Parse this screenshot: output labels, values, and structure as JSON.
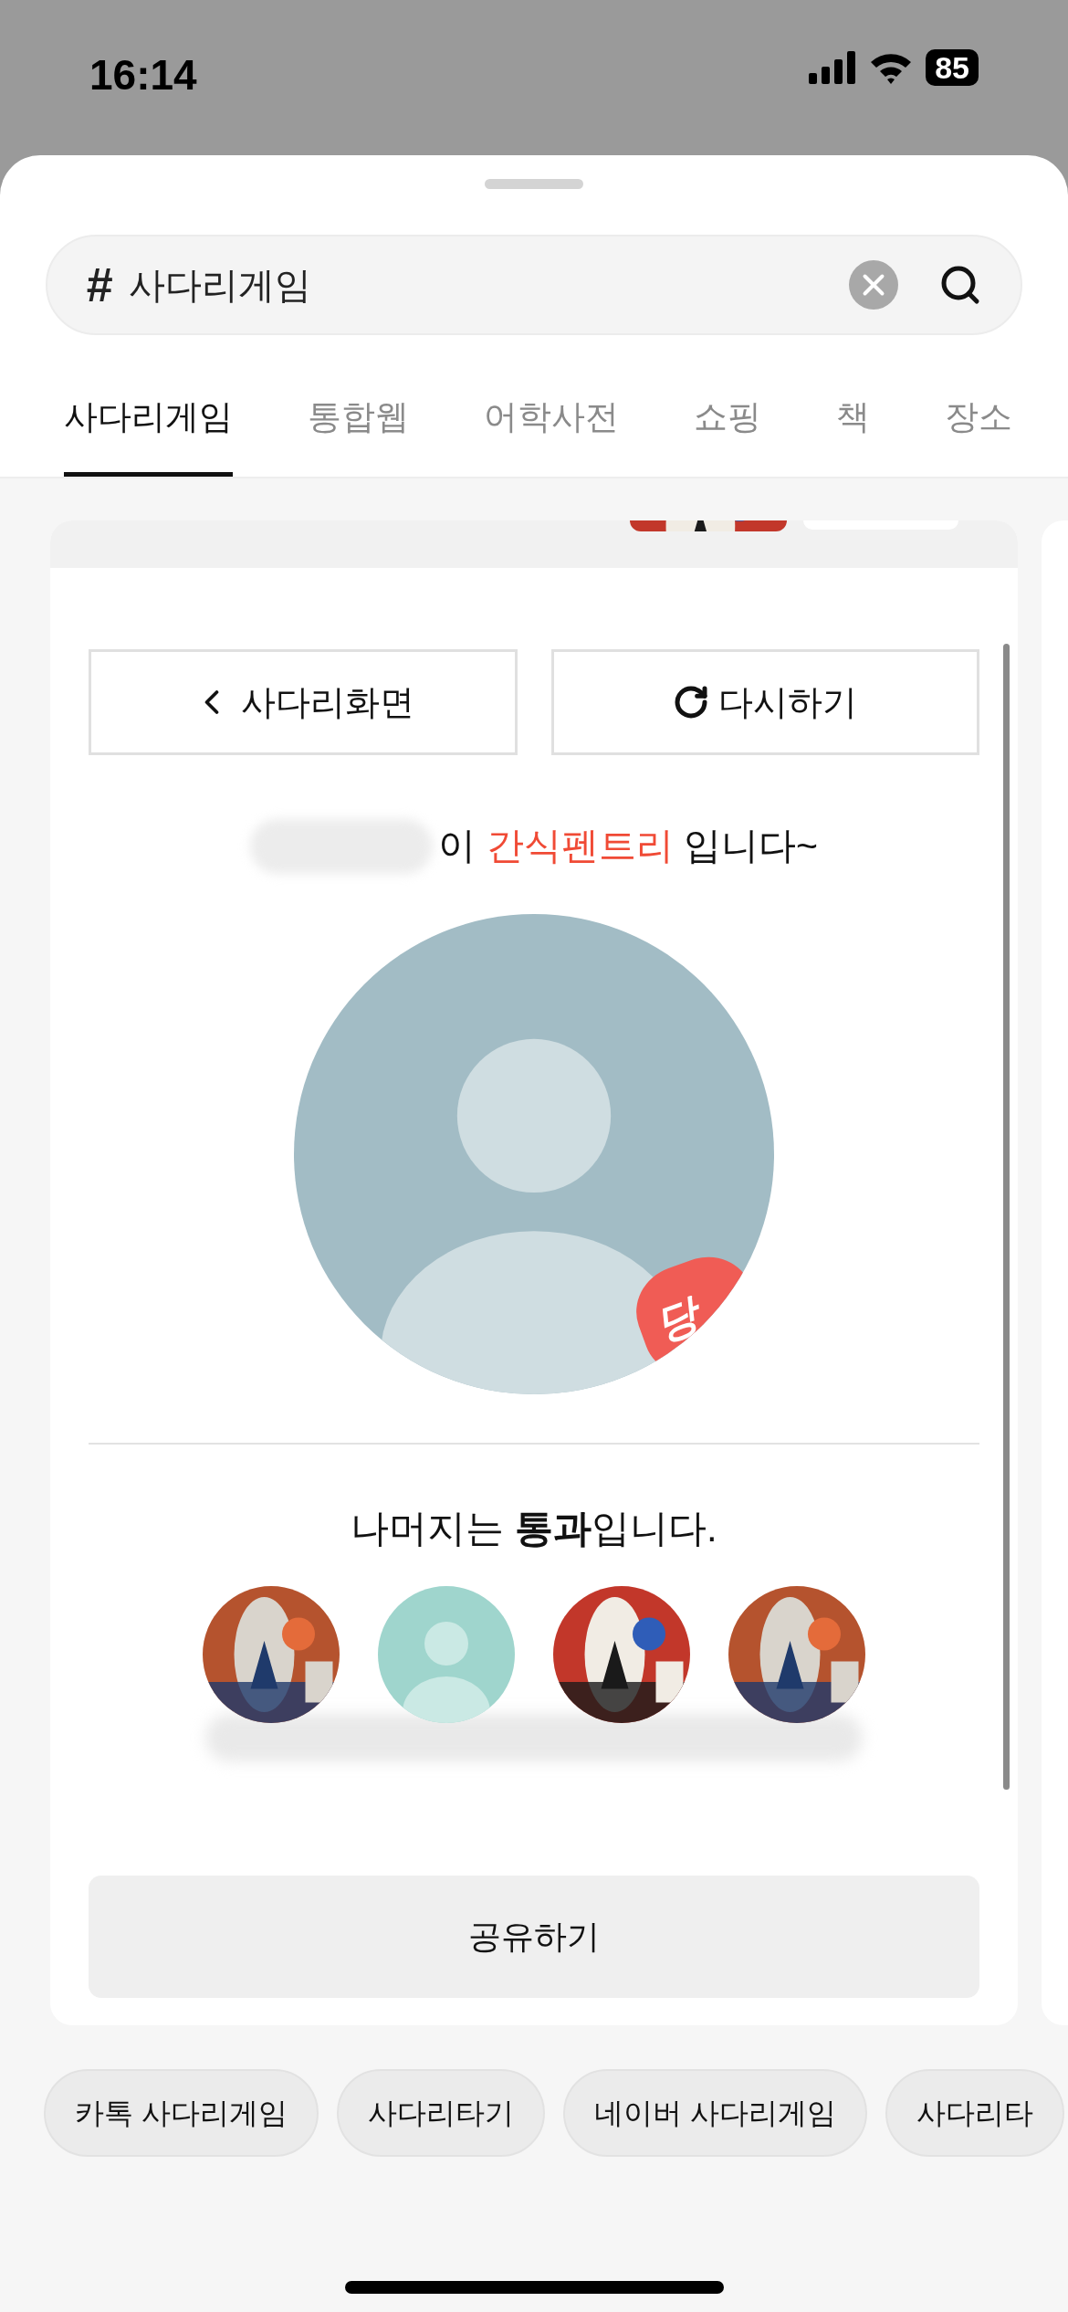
{
  "status_bar": {
    "time": "16:14",
    "battery": "85"
  },
  "search": {
    "prefix": "#",
    "value": "사다리게임"
  },
  "tabs": [
    {
      "label": "사다리게임",
      "selected": true
    },
    {
      "label": "통합웹",
      "selected": false
    },
    {
      "label": "어학사전",
      "selected": false
    },
    {
      "label": "쇼핑",
      "selected": false
    },
    {
      "label": "책",
      "selected": false
    },
    {
      "label": "장소",
      "selected": false
    }
  ],
  "result": {
    "buttons": [
      {
        "label": "사다리화면",
        "kind": "back"
      },
      {
        "label": "다시하기",
        "kind": "retry"
      }
    ],
    "message": {
      "prefix": "이 ",
      "highlight": "간식펜트리",
      "suffix": " 입니다~"
    },
    "winner": {
      "kind": "default",
      "stamp": "당"
    },
    "others_text": "나머지는 **통과**입니다.",
    "others": [
      {
        "kind": "picture"
      },
      {
        "kind": "default"
      },
      {
        "kind": "picture"
      },
      {
        "kind": "picture"
      }
    ],
    "share_button": "공유하기"
  },
  "chips": [
    "카톡 사다리게임",
    "사다리타기",
    "네이버 사다리게임",
    "사다리타"
  ]
}
